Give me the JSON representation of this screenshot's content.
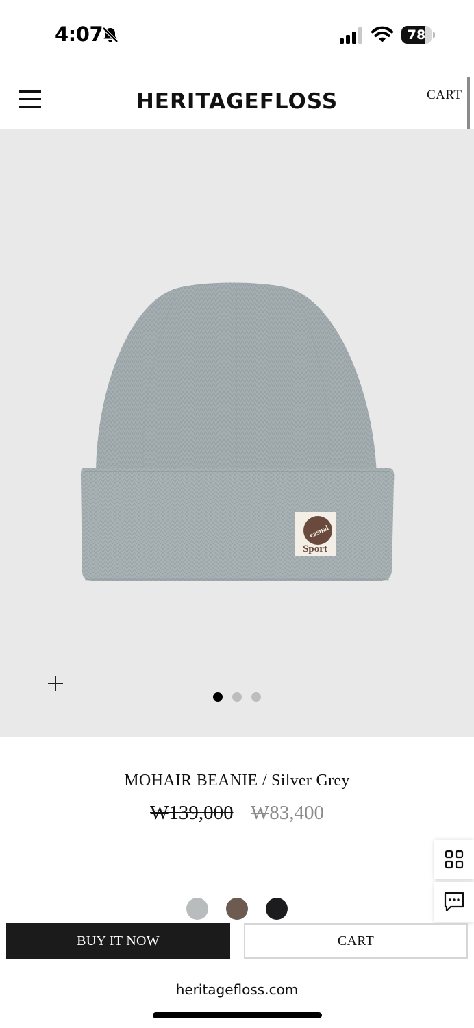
{
  "status_bar": {
    "time": "4:07",
    "battery": "78",
    "battery_level": 0.78
  },
  "header": {
    "brand": "HERITAGEFLOSS",
    "cart_label": "CART"
  },
  "gallery": {
    "slide_count": 3,
    "active_slide": 1,
    "patch": {
      "text_top": "casual",
      "text_bottom": "Sport"
    }
  },
  "product": {
    "title": "MOHAIR BEANIE / Silver Grey",
    "original_price": "₩139,000",
    "sale_price": "₩83,400",
    "color_options": [
      {
        "name": "silver-grey",
        "hex": "#b9bcbc"
      },
      {
        "name": "brown",
        "hex": "#6d5b52"
      },
      {
        "name": "black",
        "hex": "#1c1c1e"
      }
    ]
  },
  "actions": {
    "buy_label": "BUY IT NOW",
    "cart_label": "CART"
  },
  "browser": {
    "url": "heritagefloss.com"
  },
  "colors": {
    "image_bg": "#e9e9e9",
    "beanie": "#a5aeb1",
    "patch_brown": "#6b4a3e",
    "buy_button": "#1b1b1b",
    "sale_price": "#8b8b8b"
  }
}
